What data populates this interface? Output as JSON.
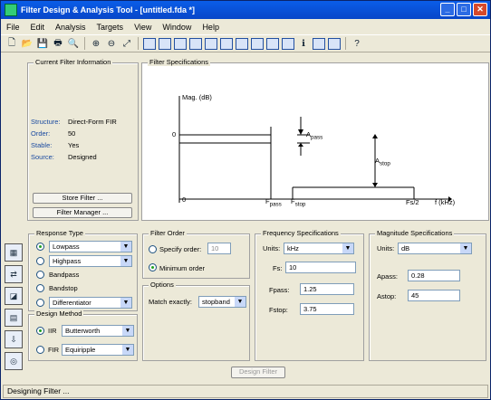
{
  "window": {
    "title": "Filter Design & Analysis Tool -  [untitled.fda *]"
  },
  "menu": [
    "File",
    "Edit",
    "Analysis",
    "Targets",
    "View",
    "Window",
    "Help"
  ],
  "current_info": {
    "title": "Current Filter Information",
    "rows": [
      {
        "k": "Structure:",
        "v": "Direct-Form FIR"
      },
      {
        "k": "Order:",
        "v": "50"
      },
      {
        "k": "Stable:",
        "v": "Yes"
      },
      {
        "k": "Source:",
        "v": "Designed"
      }
    ],
    "store": "Store Filter ...",
    "manager": "Filter Manager ..."
  },
  "spec": {
    "title": "Filter Specifications",
    "mag": "Mag. (dB)",
    "zero_y": "0",
    "zero_x": "0",
    "fpass": "F",
    "fpass_sub": "pass",
    "fstop": "F",
    "fstop_sub": "stop",
    "apass": "A",
    "apass_sub": "pass",
    "astop": "A",
    "astop_sub": "stop",
    "fs2": "Fs/2",
    "fkhz": "f (kHz)"
  },
  "response": {
    "title": "Response Type",
    "lowpass": "Lowpass",
    "highpass": "Highpass",
    "bandpass": "Bandpass",
    "bandstop": "Bandstop",
    "diff": "Differentiator"
  },
  "design": {
    "title": "Design Method",
    "iir": "IIR",
    "iir_val": "Butterworth",
    "fir": "FIR",
    "fir_val": "Equiripple"
  },
  "order": {
    "title": "Filter Order",
    "specify": "Specify order:",
    "specify_val": "10",
    "minimum": "Minimum order"
  },
  "options": {
    "title": "Options",
    "match": "Match exactly:",
    "match_val": "stopband"
  },
  "freq": {
    "title": "Frequency Specifications",
    "units": "Units:",
    "units_val": "kHz",
    "fs": "Fs:",
    "fs_val": "10",
    "fpass": "Fpass:",
    "fpass_val": "1.25",
    "fstop": "Fstop:",
    "fstop_val": "3.75"
  },
  "mag": {
    "title": "Magnitude Specifications",
    "units": "Units:",
    "units_val": "dB",
    "apass": "Apass:",
    "apass_val": "0.28",
    "astop": "Astop:",
    "astop_val": "45"
  },
  "design_btn": "Design Filter",
  "status": "Designing Filter ..."
}
